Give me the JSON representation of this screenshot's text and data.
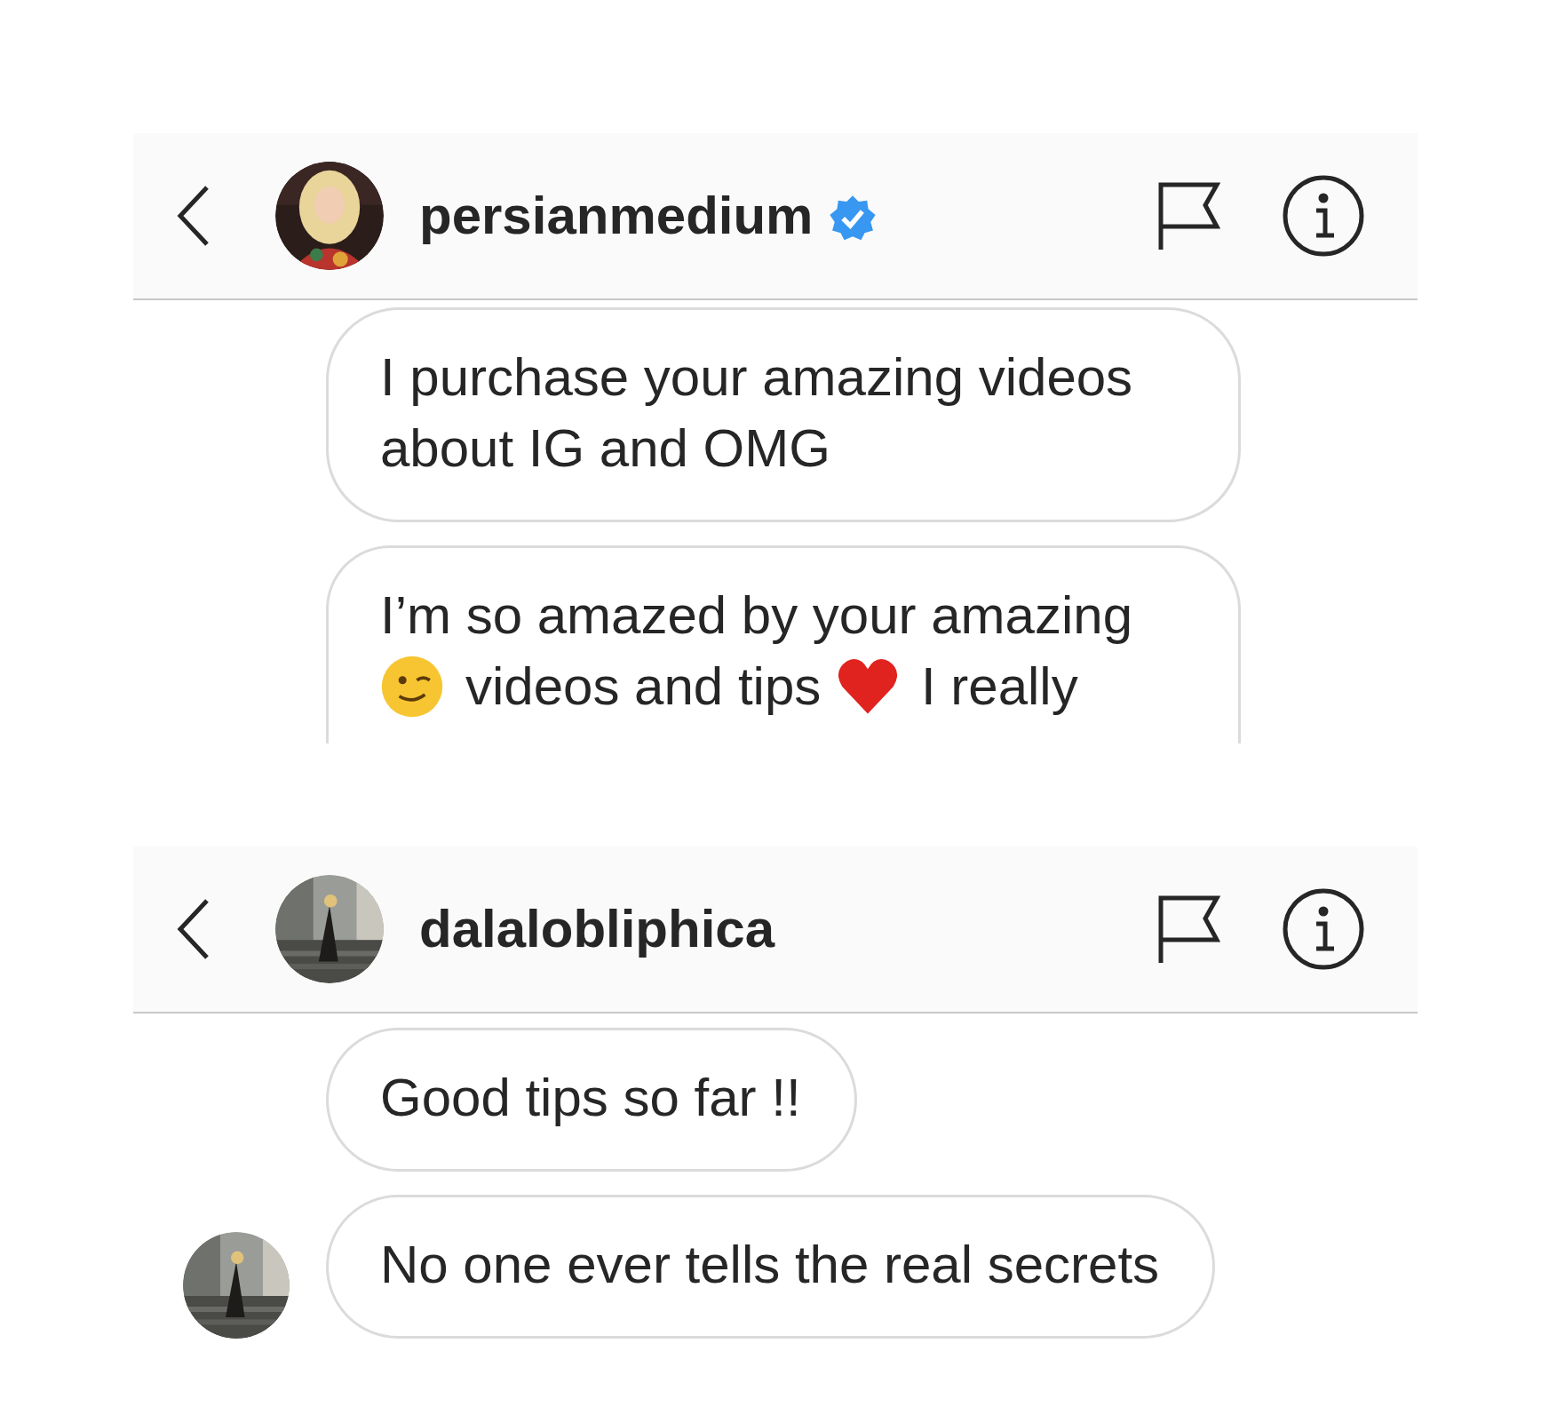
{
  "conversations": [
    {
      "header": {
        "username": "persianmedium",
        "verified": true
      },
      "cut_off": true,
      "messages": [
        {
          "show_avatar": false,
          "parts": [
            {
              "kind": "text",
              "text": "I purchase your amazing videos about IG and OMG"
            }
          ]
        },
        {
          "show_avatar": false,
          "parts": [
            {
              "kind": "text",
              "text": "I’m so amazed by your amazing"
            },
            {
              "kind": "wink"
            },
            {
              "kind": "text",
              "text": "videos and tips"
            },
            {
              "kind": "heart"
            },
            {
              "kind": "text",
              "text": "I really"
            }
          ]
        }
      ]
    },
    {
      "header": {
        "username": "dalalobliphica",
        "verified": false
      },
      "cut_off": false,
      "messages": [
        {
          "show_avatar": false,
          "parts": [
            {
              "kind": "text",
              "text": "Good tips so far !!"
            }
          ]
        },
        {
          "show_avatar": true,
          "parts": [
            {
              "kind": "text",
              "text": "No one ever tells the real secrets"
            }
          ]
        }
      ]
    }
  ]
}
